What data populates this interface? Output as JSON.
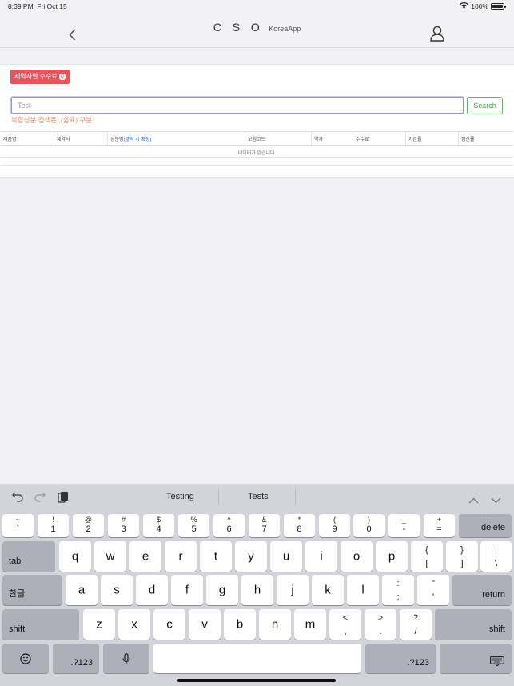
{
  "status_bar": {
    "time": "8:39 PM",
    "date": "Fri Oct 15",
    "battery_percent": "100%"
  },
  "nav": {
    "title_main": "C S O",
    "title_sub": "KoreaApp"
  },
  "filters": {
    "fee_button_label": "제약사별 수수료",
    "fee_button_badge": "Q"
  },
  "search": {
    "value": "Test",
    "button_label": "Search",
    "hint": "복합성분 검색은 ,(쉼표) 구분"
  },
  "table": {
    "columns": [
      "제품명",
      "제약사",
      "성분명",
      "보험코드",
      "약가",
      "수수료",
      "가감률",
      "정산률"
    ],
    "ingredient_hint": "(클릭 시 확장)",
    "empty_message": "데이터가 없습니다."
  },
  "keyboard": {
    "suggestions": [
      "Testing",
      "Tests"
    ],
    "number_row": [
      {
        "top": "~",
        "bottom": "`"
      },
      {
        "top": "!",
        "bottom": "1"
      },
      {
        "top": "@",
        "bottom": "2"
      },
      {
        "top": "#",
        "bottom": "3"
      },
      {
        "top": "$",
        "bottom": "4"
      },
      {
        "top": "%",
        "bottom": "5"
      },
      {
        "top": "^",
        "bottom": "6"
      },
      {
        "top": "&",
        "bottom": "7"
      },
      {
        "top": "*",
        "bottom": "8"
      },
      {
        "top": "(",
        "bottom": "9"
      },
      {
        "top": ")",
        "bottom": "0"
      },
      {
        "top": "_",
        "bottom": "-"
      },
      {
        "top": "+",
        "bottom": "="
      }
    ],
    "delete_label": "delete",
    "tab_label": "tab",
    "row_q": [
      "q",
      "w",
      "e",
      "r",
      "t",
      "y",
      "u",
      "i",
      "o",
      "p"
    ],
    "row_q_symbols": [
      {
        "top": "{",
        "bottom": "["
      },
      {
        "top": "}",
        "bottom": "]"
      },
      {
        "top": "|",
        "bottom": "\\"
      }
    ],
    "lang_label": "한글",
    "row_a": [
      "a",
      "s",
      "d",
      "f",
      "g",
      "h",
      "j",
      "k",
      "l"
    ],
    "row_a_symbols": [
      {
        "top": ":",
        "bottom": ";"
      },
      {
        "top": "\"",
        "bottom": "'"
      }
    ],
    "return_label": "return",
    "shift_label": "shift",
    "row_z": [
      "z",
      "x",
      "c",
      "v",
      "b",
      "n",
      "m"
    ],
    "row_z_symbols": [
      {
        "top": "<",
        "bottom": ","
      },
      {
        "top": ">",
        "bottom": "."
      },
      {
        "top": "?",
        "bottom": "/"
      }
    ],
    "numbers_label": ".?123"
  }
}
